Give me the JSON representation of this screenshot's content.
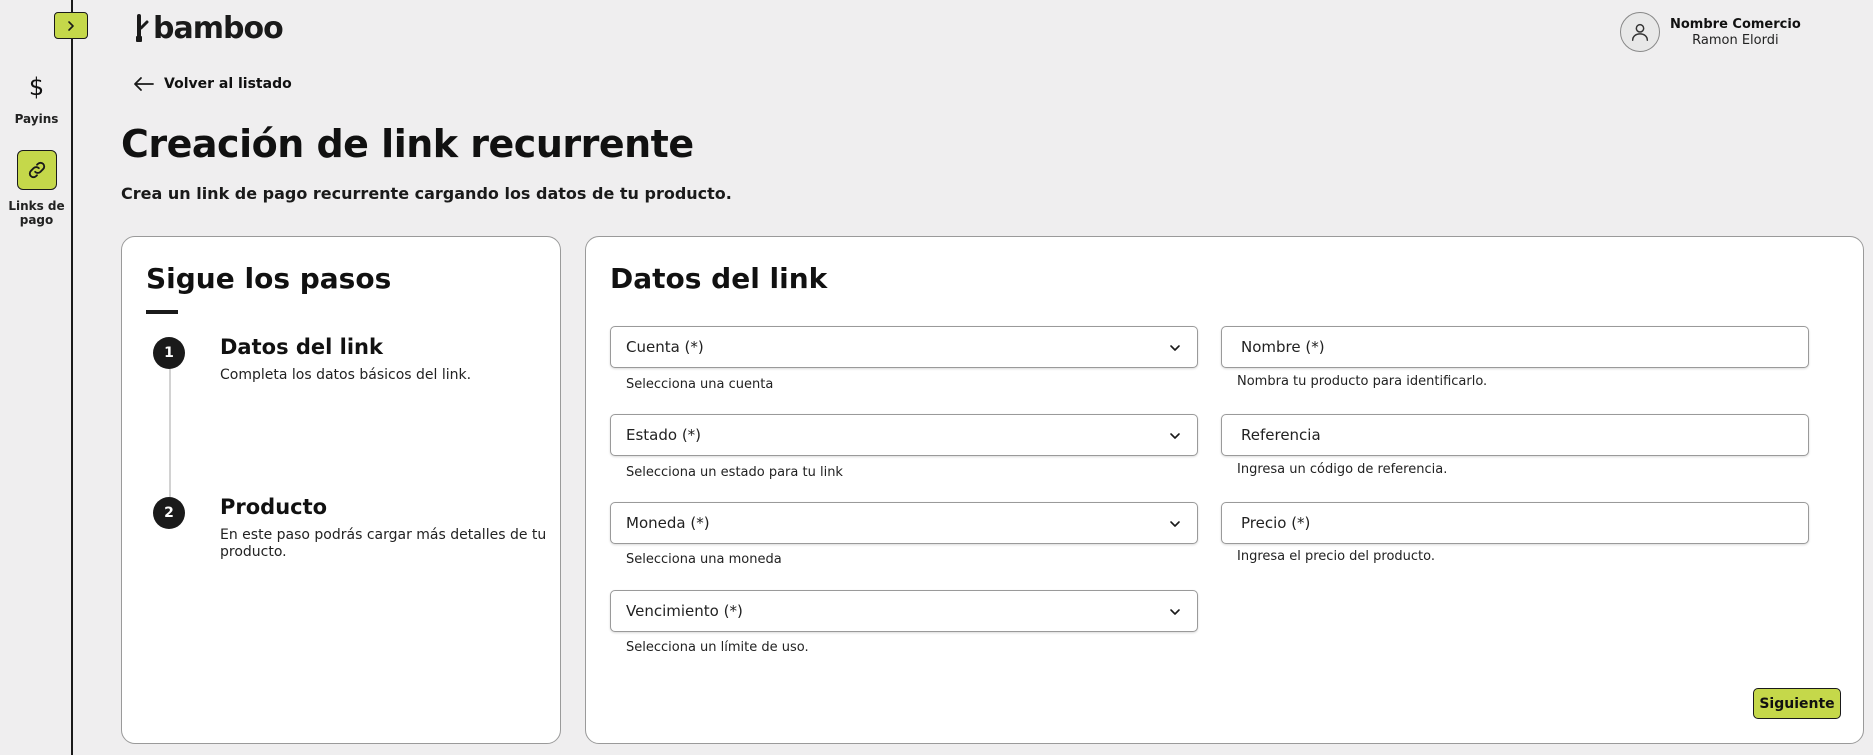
{
  "sidebar": {
    "items": [
      {
        "label": "Payins",
        "icon": "dollar-icon",
        "glyph": "$"
      },
      {
        "label": "Links de pago",
        "icon": "link-icon"
      }
    ]
  },
  "brand": {
    "name": "bamboo",
    "accent": "#c5d84a"
  },
  "user": {
    "business": "Nombre Comercio",
    "name": "Ramon Elordi"
  },
  "nav": {
    "back_label": "Volver al listado"
  },
  "page": {
    "title": "Creación de link recurrente",
    "subtitle": "Crea un link de pago recurrente cargando los datos de tu producto."
  },
  "steps": {
    "title": "Sigue los pasos",
    "items": [
      {
        "number": "1",
        "title": "Datos del link",
        "description": "Completa los datos básicos del link."
      },
      {
        "number": "2",
        "title": "Producto",
        "description": "En este paso podrás cargar más detalles de tu producto."
      }
    ]
  },
  "form": {
    "title": "Datos del link",
    "left_fields": [
      {
        "label": "Cuenta (*)",
        "hint": "Selecciona una cuenta"
      },
      {
        "label": "Estado (*)",
        "hint": "Selecciona un estado para tu link"
      },
      {
        "label": "Moneda (*)",
        "hint": "Selecciona una moneda"
      },
      {
        "label": "Vencimiento (*)",
        "hint": "Selecciona un límite de uso."
      }
    ],
    "right_fields": [
      {
        "placeholder": "Nombre (*)",
        "hint": "Nombra tu producto para identificarlo."
      },
      {
        "placeholder": "Referencia",
        "hint": "Ingresa un código de referencia."
      },
      {
        "placeholder": "Precio (*)",
        "hint": "Ingresa el precio del producto."
      }
    ],
    "next_label": "Siguiente"
  }
}
